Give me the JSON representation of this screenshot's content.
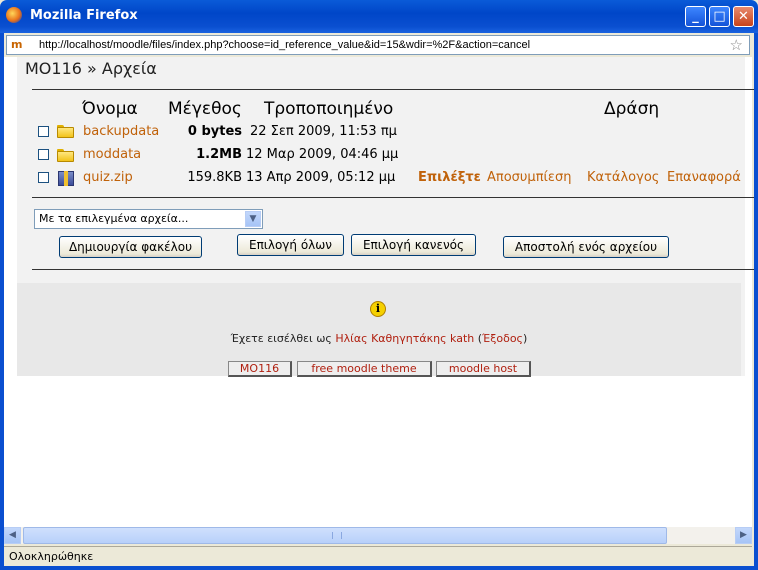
{
  "window": {
    "title": "Mozilla Firefox",
    "minimize": "_",
    "maximize": "□",
    "close": "✕"
  },
  "urlbar": {
    "url": "http://localhost/moodle/files/index.php?choose=id_reference_value&id=15&wdir=%2F&action=cancel",
    "site_icon": "m"
  },
  "breadcrumb": "MO116 » Αρχεία",
  "table": {
    "headers": {
      "name": "Όνομα",
      "size": "Μέγεθος",
      "modified": "Τροποποιημένο",
      "action": "Δράση"
    },
    "rows": [
      {
        "name": "backupdata",
        "size": "0 bytes",
        "modified": "22 Σεπ 2009, 11:53 πμ",
        "type": "folder"
      },
      {
        "name": "moddata",
        "size": "1.2MB",
        "modified": "12 Μαρ 2009, 04:46 μμ",
        "type": "folder"
      },
      {
        "name": "quiz.zip",
        "size": "159.8KB",
        "modified": "13 Απρ 2009, 05:12 μμ",
        "type": "zip",
        "actions": {
          "choose": "Επιλέξτε",
          "unzip": "Αποσυμπίεση",
          "list": "Κατάλογος",
          "restore": "Επαναφορά"
        }
      }
    ]
  },
  "controls": {
    "select_value": "Με τα επιλεγμένα αρχεία...",
    "create_folder": "Δημιουργία φακέλου",
    "select_all": "Επιλογή όλων",
    "select_none": "Επιλογή κανενός",
    "upload": "Αποστολή ενός αρχείου"
  },
  "footer": {
    "logged_in_prefix": "Έχετε εισέλθει ως",
    "user": "Ηλίας Καθηγητάκης kath",
    "logout_open": "(",
    "logout": "Έξοδος",
    "logout_close": ")",
    "buttons": [
      "MO116",
      "free moodle theme",
      "moodle host"
    ]
  },
  "status": "Ολοκληρώθηκε",
  "icons": {
    "info": "info-icon",
    "star": "bookmark-star-icon"
  }
}
